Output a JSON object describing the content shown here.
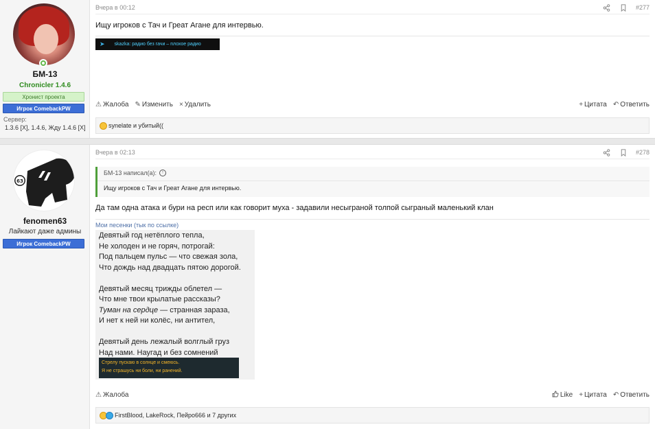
{
  "posts": [
    {
      "user": {
        "name": "БМ-13",
        "title": "Chronicler 1.4.6",
        "title_color": "#2e8b1e",
        "banner_green": "Хронист проекта",
        "banner_blue": "Игрок ComebackPW",
        "server_label": "Сервер:",
        "server_value": "1.3.6 [X], 1.4.6, Жду 1.4.6 [X]"
      },
      "meta": {
        "time": "Вчера в 00:12",
        "number": "#277"
      },
      "message": "Ищу игроков с Тач и Греат Агане для интервью.",
      "signature_banner": "skazka: радио без гачи – плохое радио",
      "actions": {
        "report": "Жалоба",
        "edit": "Изменить",
        "delete": "Удалить",
        "quote": "Цитата",
        "reply": "Ответить"
      },
      "reactions": "synelate и убитый(("
    },
    {
      "user": {
        "name": "fenomen63",
        "title": "Лайкают даже админы",
        "banner_blue": "Игрок ComebackPW",
        "avatar_badge": "63"
      },
      "meta": {
        "time": "Вчера в 02:13",
        "number": "#278"
      },
      "quote": {
        "author": "БМ-13 написал(а):",
        "text": "Ищу игроков с Тач и Греат Агане для интервью."
      },
      "message": "Да там одна атака и бури на респ или как говорит муха - задавили несыграной толпой сыграный маленький клан",
      "songs_link": "Мои песенки (тык по ссылке)",
      "poem": {
        "stanza1": [
          "Девятый год нетёплого тепла,",
          "Не холоден и не горяч, потрогай:",
          "Под пальцем пульс — что свежая зола,",
          "Что дождь над двадцать пятою дорогой."
        ],
        "stanza2": [
          "Девятый месяц трижды облетел —",
          "Что мне твои крылатые рассказы?",
          "Туман на сердце",
          " — странная зараза,",
          "И нет к ней ни колёс, ни антител,"
        ],
        "stanza3": [
          "Девятый день лежалый волглый груз",
          "Над нами. Наугад и без сомнений"
        ],
        "banner": [
          "Стрелу пускаю в солнце и смеюсь.",
          "Я не страшусь ни боли, ни ранений."
        ]
      },
      "actions": {
        "report": "Жалоба",
        "like": "Like",
        "quote": "Цитата",
        "reply": "Ответить"
      },
      "reactions": "FirstBlood, LakeRock, Пейро666 и 7 других"
    }
  ],
  "icons": {
    "share": "share-icon",
    "bookmark": "bookmark-icon",
    "report": "warning-icon",
    "edit": "pencil-icon",
    "delete": "x-icon",
    "quote": "plus-icon",
    "reply": "reply-icon",
    "like": "thumbs-up-icon"
  }
}
